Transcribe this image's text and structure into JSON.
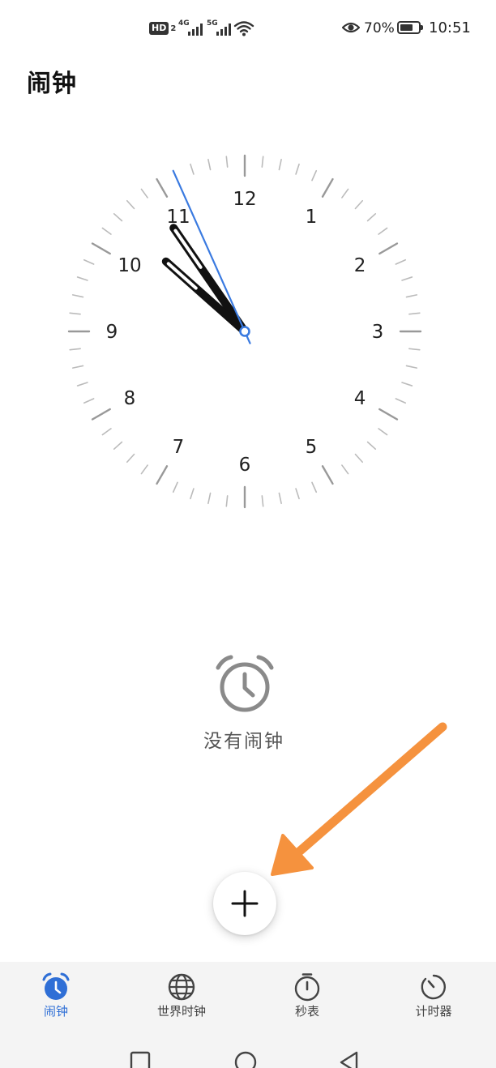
{
  "status_bar": {
    "hd_label": "HD",
    "hd_sub": "2",
    "sim1_network": "4G",
    "sim2_network": "5G",
    "battery_percent": "70%",
    "battery_level": 0.7,
    "time": "10:51",
    "icons": [
      "hd-icon",
      "signal-icon",
      "wifi-icon",
      "eye-icon",
      "battery-icon"
    ]
  },
  "page": {
    "title": "闹钟"
  },
  "clock": {
    "numerals": [
      "12",
      "1",
      "2",
      "3",
      "4",
      "5",
      "6",
      "7",
      "8",
      "9",
      "10",
      "11"
    ],
    "hour": 10,
    "minute": 51,
    "second": 56,
    "hand_color": "#111111",
    "second_hand_color": "#3a7ae0",
    "tick_color": "#bbbbbb",
    "major_tick_color": "#999999"
  },
  "empty_state": {
    "icon": "alarm-clock-icon",
    "message": "没有闹钟"
  },
  "fab": {
    "icon": "plus-icon"
  },
  "annotation": {
    "color": "#f5923e"
  },
  "bottom_nav": {
    "accent": "#2f6fd6",
    "items": [
      {
        "label": "闹钟",
        "icon": "alarm-icon",
        "active": true
      },
      {
        "label": "世界时钟",
        "icon": "globe-icon",
        "active": false
      },
      {
        "label": "秒表",
        "icon": "stopwatch-icon",
        "active": false
      },
      {
        "label": "计时器",
        "icon": "timer-icon",
        "active": false
      }
    ]
  },
  "system_nav": {
    "icons": [
      "recents-icon",
      "home-icon",
      "back-icon"
    ]
  }
}
